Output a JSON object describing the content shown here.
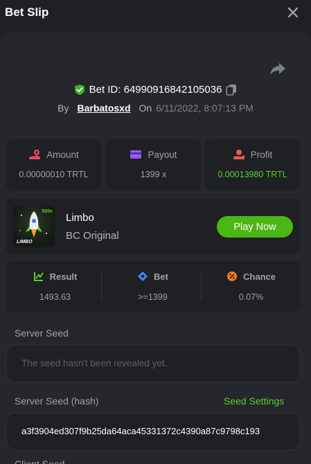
{
  "header": {
    "title": "Bet Slip"
  },
  "bet": {
    "id_text": "Bet ID: 64990916842105036",
    "by_label": "By",
    "username": "Barbatosxd",
    "on_label": "On",
    "date": "6/11/2022, 8:07:13 PM"
  },
  "stats": [
    {
      "label": "Amount",
      "value": "0.00000010 TRTL",
      "icon": "amount-icon",
      "icon_color": "#e8476a"
    },
    {
      "label": "Payout",
      "value": "1399 x",
      "icon": "payout-icon",
      "icon_color": "#9b59ff"
    },
    {
      "label": "Profit",
      "value": "0.00013980 TRTL",
      "icon": "profit-icon",
      "icon_color": "#f05a4f",
      "value_color": "#5bce26"
    }
  ],
  "game": {
    "name": "Limbo",
    "subtitle": "BC Original",
    "thumb_label": "LIMBO",
    "thumb_badge": "500x",
    "play_label": "Play Now"
  },
  "results": [
    {
      "label": "Result",
      "value": "1493.63",
      "icon": "result-icon",
      "icon_color": "#5bce26"
    },
    {
      "label": "Bet",
      "value": ">=1399",
      "icon": "bet-icon",
      "icon_color": "#3c8cff"
    },
    {
      "label": "Chance",
      "value": "0.07%",
      "icon": "chance-icon",
      "icon_color": "#f57a23"
    }
  ],
  "server_seed": {
    "label": "Server Seed",
    "placeholder": "The seed hasn't been revealed yet."
  },
  "server_seed_hash": {
    "label": "Server Seed (hash)",
    "settings_label": "Seed Settings",
    "value": "a3f3904ed307f9b25da64aca45331372c4390a87c9798c193"
  },
  "client_seed": {
    "label": "Client Seed"
  },
  "colors": {
    "accent": "#4bb614",
    "background": "#1e2024",
    "panel": "#25272c"
  }
}
